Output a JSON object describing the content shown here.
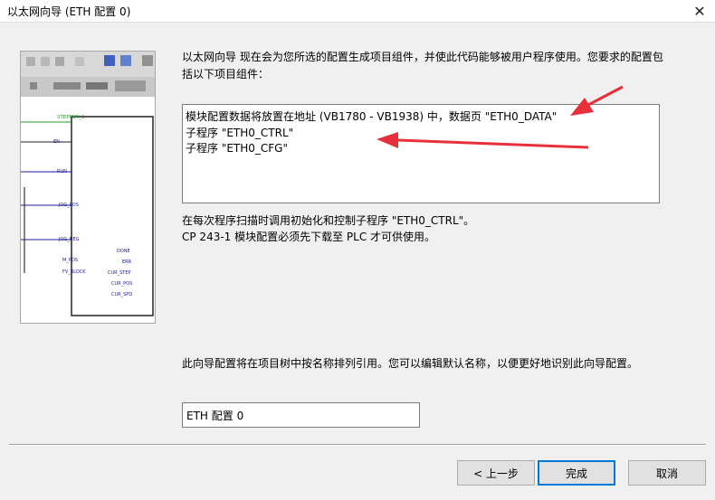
{
  "window": {
    "title": "以太网向导 (ETH 配置 0)"
  },
  "intro": {
    "line1": "以太网向导 现在会为您所选的配置生成项目组件，并使此代码能够被用户程序使用。您要求的配置包",
    "line2": "括以下项目组件："
  },
  "components": {
    "items": [
      "模块配置数据将放置在地址 (VB1780 - VB1938) 中，数据页 \"ETH0_DATA\"",
      "子程序 \"ETH0_CTRL\"",
      "子程序 \"ETH0_CFG\""
    ]
  },
  "notes": {
    "line1": "在每次程序扫描时调用初始化和控制子程序 \"ETH0_CTRL\"。",
    "line2": "CP 243-1  模块配置必须先下载至 PLC 才可供使用。"
  },
  "naming": {
    "text": "此向导配置将在项目树中按名称排列引用。您可以编辑默认名称，以便更好地识别此向导配置。",
    "value": "ETH 配置 0"
  },
  "illustration": {
    "block_name": "STEPPER_1",
    "inputs": [
      "EN",
      "RUN",
      "JOG_POS",
      "JOG_NEG",
      "M_POS",
      "FV_BLOCK"
    ],
    "outputs": [
      "DONE",
      "ERR",
      "CUR_STEP",
      "CUR_POS",
      "CUR_SPD"
    ]
  },
  "annotations": {
    "arrow_color": "#e8303a"
  },
  "buttons": {
    "back": "< 上一步",
    "finish": "完成",
    "cancel": "取消"
  }
}
